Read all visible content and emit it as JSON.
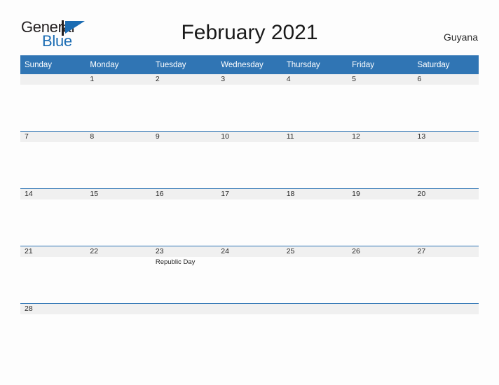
{
  "brand": {
    "name_part1": "General",
    "name_part2": "Blue",
    "flag_icon": "blue-flag-icon",
    "accent_color": "#1b6cb3"
  },
  "header": {
    "title": "February 2021",
    "region": "Guyana"
  },
  "theme": {
    "header_blue": "#3075b4",
    "rule_blue": "#2f75b5",
    "date_band_gray": "#f0f0f0",
    "page_background": "#fdfdfd",
    "text_color": "#262626"
  },
  "calendar": {
    "month": "February",
    "year": "2021",
    "weekday_headers": [
      "Sunday",
      "Monday",
      "Tuesday",
      "Wednesday",
      "Thursday",
      "Friday",
      "Saturday"
    ],
    "weeks": [
      [
        {
          "date": "",
          "events": []
        },
        {
          "date": "1",
          "events": []
        },
        {
          "date": "2",
          "events": []
        },
        {
          "date": "3",
          "events": []
        },
        {
          "date": "4",
          "events": []
        },
        {
          "date": "5",
          "events": []
        },
        {
          "date": "6",
          "events": []
        }
      ],
      [
        {
          "date": "7",
          "events": []
        },
        {
          "date": "8",
          "events": []
        },
        {
          "date": "9",
          "events": []
        },
        {
          "date": "10",
          "events": []
        },
        {
          "date": "11",
          "events": []
        },
        {
          "date": "12",
          "events": []
        },
        {
          "date": "13",
          "events": []
        }
      ],
      [
        {
          "date": "14",
          "events": []
        },
        {
          "date": "15",
          "events": []
        },
        {
          "date": "16",
          "events": []
        },
        {
          "date": "17",
          "events": []
        },
        {
          "date": "18",
          "events": []
        },
        {
          "date": "19",
          "events": []
        },
        {
          "date": "20",
          "events": []
        }
      ],
      [
        {
          "date": "21",
          "events": []
        },
        {
          "date": "22",
          "events": []
        },
        {
          "date": "23",
          "events": [
            "Republic Day"
          ]
        },
        {
          "date": "24",
          "events": []
        },
        {
          "date": "25",
          "events": []
        },
        {
          "date": "26",
          "events": []
        },
        {
          "date": "27",
          "events": []
        }
      ],
      [
        {
          "date": "28",
          "events": []
        },
        {
          "date": "",
          "events": []
        },
        {
          "date": "",
          "events": []
        },
        {
          "date": "",
          "events": []
        },
        {
          "date": "",
          "events": []
        },
        {
          "date": "",
          "events": []
        },
        {
          "date": "",
          "events": []
        }
      ]
    ]
  }
}
